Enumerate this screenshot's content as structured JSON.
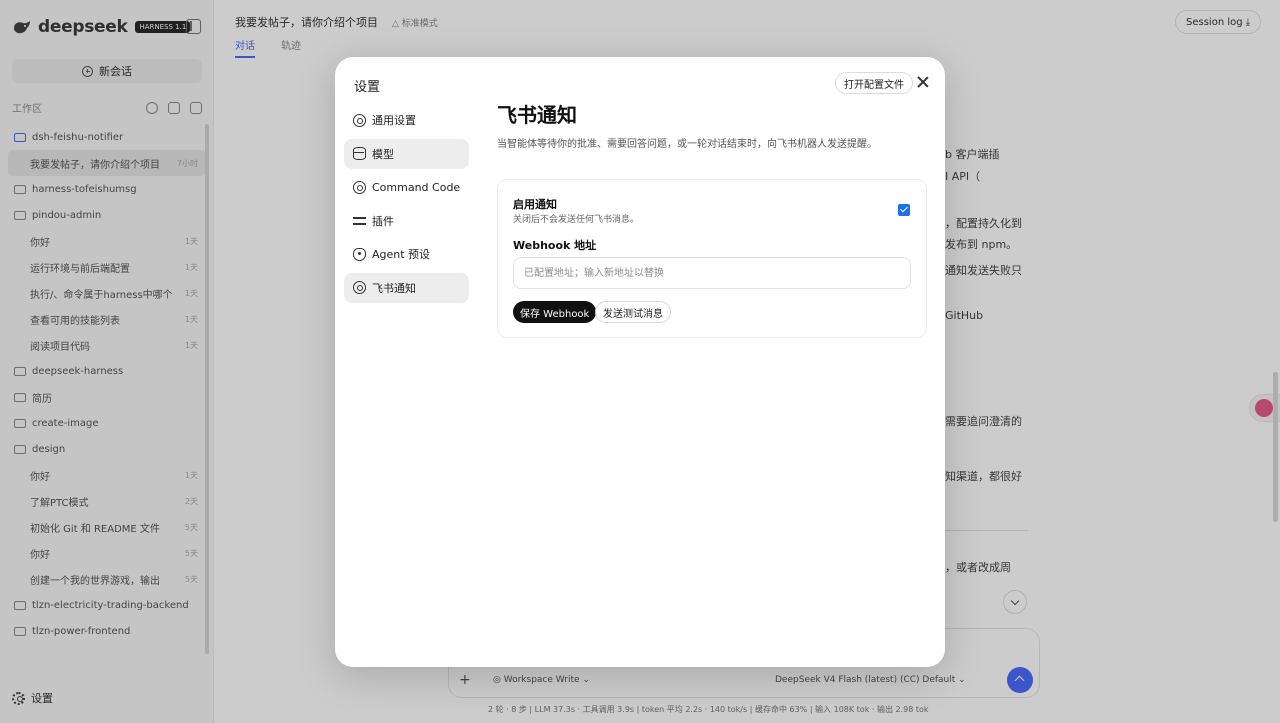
{
  "app": {
    "brand": "deepseek",
    "brand_badge": "HARNESS 1.1",
    "new_chat_label": "新会话",
    "workspace_label": "工作区",
    "footer_settings_label": "设置"
  },
  "tree": [
    {
      "type": "folder",
      "label": "dsh-feishu-notifier",
      "active": true
    },
    {
      "type": "child",
      "label": "我要发帖子，请你介绍个项目",
      "age": "7小时",
      "selected": true
    },
    {
      "type": "folder",
      "label": "harness-tofeishumsg"
    },
    {
      "type": "folder",
      "label": "pindou-admin"
    },
    {
      "type": "child",
      "label": "你好",
      "age": "1天"
    },
    {
      "type": "child",
      "label": "运行环境与前后端配置",
      "age": "1天"
    },
    {
      "type": "child",
      "label": "执行/、命令属于harness中哪个",
      "age": "1天"
    },
    {
      "type": "child",
      "label": "查看可用的技能列表",
      "age": "1天"
    },
    {
      "type": "child",
      "label": "阅读项目代码",
      "age": "1天"
    },
    {
      "type": "folder",
      "label": "deepseek-harness"
    },
    {
      "type": "folder",
      "label": "简历"
    },
    {
      "type": "folder",
      "label": "create-image"
    },
    {
      "type": "folder",
      "label": "design"
    },
    {
      "type": "child",
      "label": "你好",
      "age": "1天"
    },
    {
      "type": "child",
      "label": "了解PTC模式",
      "age": "2天"
    },
    {
      "type": "child",
      "label": "初始化 Git 和 README 文件",
      "age": "5天"
    },
    {
      "type": "child",
      "label": "你好",
      "age": "5天"
    },
    {
      "type": "child",
      "label": "创建一个我的世界游戏，输出",
      "age": "5天"
    },
    {
      "type": "folder",
      "label": "tlzn-electricity-trading-backend"
    },
    {
      "type": "folder",
      "label": "tlzn-power-frontend"
    }
  ],
  "header": {
    "chat_title": "我要发帖子，请你介绍个项目",
    "mode": "标准模式",
    "tabs": [
      "对话",
      "轨迹"
    ],
    "session_log": "Session log"
  },
  "background_lines": [
    "b 客户端插",
    "I API（",
    "，配置持久化到",
    "发布到 npm。",
    "通知发送失败只",
    "GitHub",
    "需要追问澄清的",
    "知渠道，都很好",
    "，或者改成周"
  ],
  "composer": {
    "mode": "Workspace Write",
    "model": "DeepSeek V4 Flash (latest) (CC)  Default"
  },
  "status_bar": "2 轮 · 8 步  |  LLM 37.3s · 工具调用 3.9s  |  token 平均 2.2s · 140 tok/s  |  缓存命中 63%  |  输入 108K tok · 输出 2.98 tok",
  "settings": {
    "title": "设置",
    "open_config": "打开配置文件",
    "nav": [
      {
        "label": "通用设置",
        "icon": "gear-icon"
      },
      {
        "label": "模型",
        "icon": "database-icon"
      },
      {
        "label": "Command Code",
        "icon": "gear-icon"
      },
      {
        "label": "插件",
        "icon": "sliders-icon"
      },
      {
        "label": "Agent 预设",
        "icon": "agent-icon"
      },
      {
        "label": "飞书通知",
        "icon": "gear-icon"
      }
    ],
    "panel": {
      "title": "飞书通知",
      "description": "当智能体等待你的批准、需要回答问题，或一轮对话结束时，向飞书机器人发送提醒。",
      "enable_label": "启用通知",
      "enable_hint": "关闭后不会发送任何飞书消息。",
      "enabled": true,
      "webhook_label": "Webhook 地址",
      "webhook_value": "",
      "webhook_placeholder": "已配置地址；输入新地址以替换",
      "save_button": "保存 Webhook",
      "test_button": "发送测试消息"
    }
  }
}
